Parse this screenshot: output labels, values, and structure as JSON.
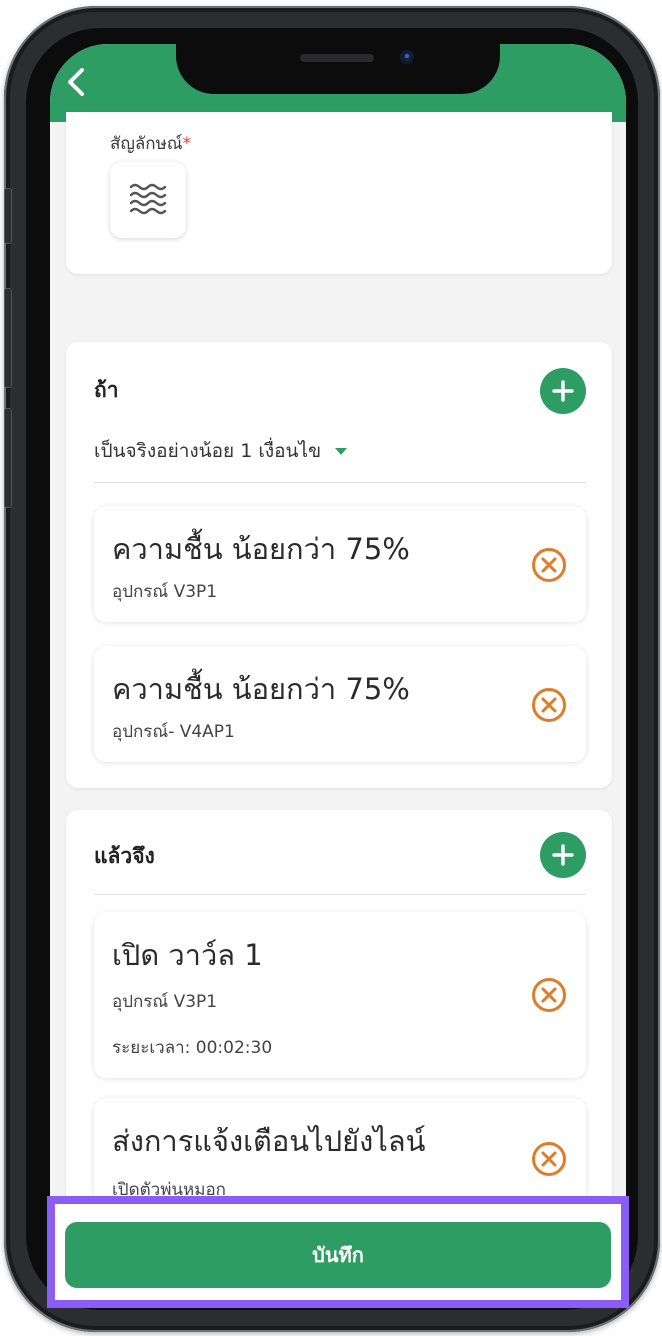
{
  "header": {
    "back_icon": "chevron-left-icon",
    "color": "#2e9d63"
  },
  "symbol_section": {
    "label": "สัญลักษณ์",
    "required_mark": "*",
    "selected_icon": "water-waves-icon"
  },
  "if_section": {
    "title": "ถ้า",
    "add_icon": "plus-icon",
    "condition_mode": "เป็นจริงอย่างน้อย 1 เงื่อนไข",
    "conditions": [
      {
        "title": "ความชื้น น้อยกว่า 75%",
        "device": "อุปกรณ์ V3P1"
      },
      {
        "title": "ความชื้น น้อยกว่า 75%",
        "device": "อุปกรณ์- V4AP1"
      }
    ]
  },
  "then_section": {
    "title": "แล้วจึง",
    "add_icon": "plus-icon",
    "actions": [
      {
        "title": "เปิด วาว์ล 1",
        "device": "อุปกรณ์ V3P1",
        "duration": "ระยะเวลา: 00:02:30"
      },
      {
        "title": "ส่งการแจ้งเตือนไปยังไลน์",
        "device": "เปิดตัวพ่นหมอก"
      }
    ]
  },
  "save_button": {
    "label": "บันทึก"
  },
  "colors": {
    "accent": "#2e9d63",
    "remove": "#e07b2a",
    "highlight": "#8b5cf6"
  }
}
